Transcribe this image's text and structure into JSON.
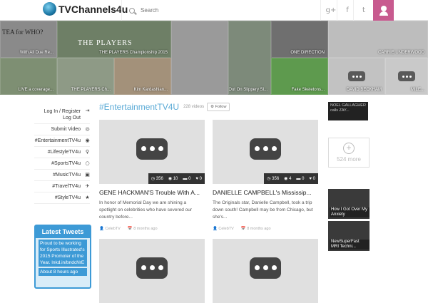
{
  "header": {
    "logo_text": "TVChannels4u",
    "search_placeholder": "Search",
    "social": [
      "g+",
      "f",
      "t"
    ],
    "user_icon": "user-icon",
    "accent": "#c85a8f"
  },
  "banner": {
    "tiles": [
      {
        "caption": "With All Due Re...",
        "tile_text": "TEA for WHO?",
        "color": "#8a8a8a"
      },
      {
        "caption": "THE PLAYERS Championship 2015",
        "tile_text": "THE PLAYERS",
        "color": "#6e7f66"
      },
      {
        "caption": "",
        "tile_text": "",
        "color": "#9a9a9a"
      },
      {
        "caption": "Kid Wipes Out On Slippery Sl...",
        "tile_text": "",
        "color": "#7d8a7a"
      },
      {
        "caption": "ONE DIRECTION",
        "tile_text": "",
        "color": "#6f6f6f"
      },
      {
        "caption": "CARRIE UNDERWOOD",
        "tile_text": "",
        "color": "#bdbdbd"
      },
      {
        "caption": "LIVE a coverage...",
        "tile_text": "",
        "color": "#7e8f73"
      },
      {
        "caption": "THE PLAYERS Ch...",
        "tile_text": "",
        "color": "#8e9a86"
      },
      {
        "caption": "Kim Kardashian...",
        "tile_text": "",
        "color": "#a3917a"
      },
      {
        "caption": "Fake Skeletons...",
        "tile_text": "",
        "color": "#5e9a4e"
      },
      {
        "caption": "DAVID BECKHAM",
        "tile_text": "",
        "color": "#c2c2c2"
      },
      {
        "caption": "MILE...",
        "tile_text": "",
        "color": "#c9c9c9"
      }
    ]
  },
  "sidebar": {
    "login_line1": "Log In / Register",
    "login_line2": "Log Out",
    "items": [
      {
        "label": "Submit Video",
        "icon": "◎"
      },
      {
        "label": "#EntertainmentTV4u",
        "icon": "◉"
      },
      {
        "label": "#LifestyleTV4u",
        "icon": "♀"
      },
      {
        "label": "#SportsTV4u",
        "icon": "○"
      },
      {
        "label": "#MusicTV4u",
        "icon": "▣"
      },
      {
        "label": "#TravelTV4u",
        "icon": "✈"
      },
      {
        "label": "#StyleTV4u",
        "icon": "★"
      }
    ],
    "tweets_title": "Latest Tweets",
    "tweet_text": "Proud to be working for Sports Illustrated's 2015 Promoter of the Year. lnkd.in/bndcNrE",
    "tweet_time": "About 8 hours ago"
  },
  "main": {
    "title": "#EntertainmentTV4U",
    "video_count": "228 videos",
    "follow_label": "Follow",
    "cards": [
      {
        "title": "GENE HACKMAN'S Trouble With A...",
        "desc": "In honor of Memorial Day we are shining a spotlight on celebrities who have severed our country before...",
        "stats": [
          "356",
          "10",
          "0",
          "0"
        ],
        "author": "CelebTV",
        "date": "8 months ago"
      },
      {
        "title": "DANIELLE CAMPBELL's Mississip...",
        "desc": "The Originals star, Danielle Campbell, took a trip down south! Campbell may be from Chicago, but she's...",
        "stats": [
          "356",
          "4",
          "0",
          "0"
        ],
        "author": "CelebTV",
        "date": "8 months ago"
      }
    ]
  },
  "right": {
    "promo_text": "NOEL GALLAGHER calls ZAY...",
    "more_label": "524 more",
    "videos": [
      {
        "title": "How I Got Over My Anxiety"
      },
      {
        "title": "NewSuperFast MRI Techni..."
      }
    ]
  }
}
